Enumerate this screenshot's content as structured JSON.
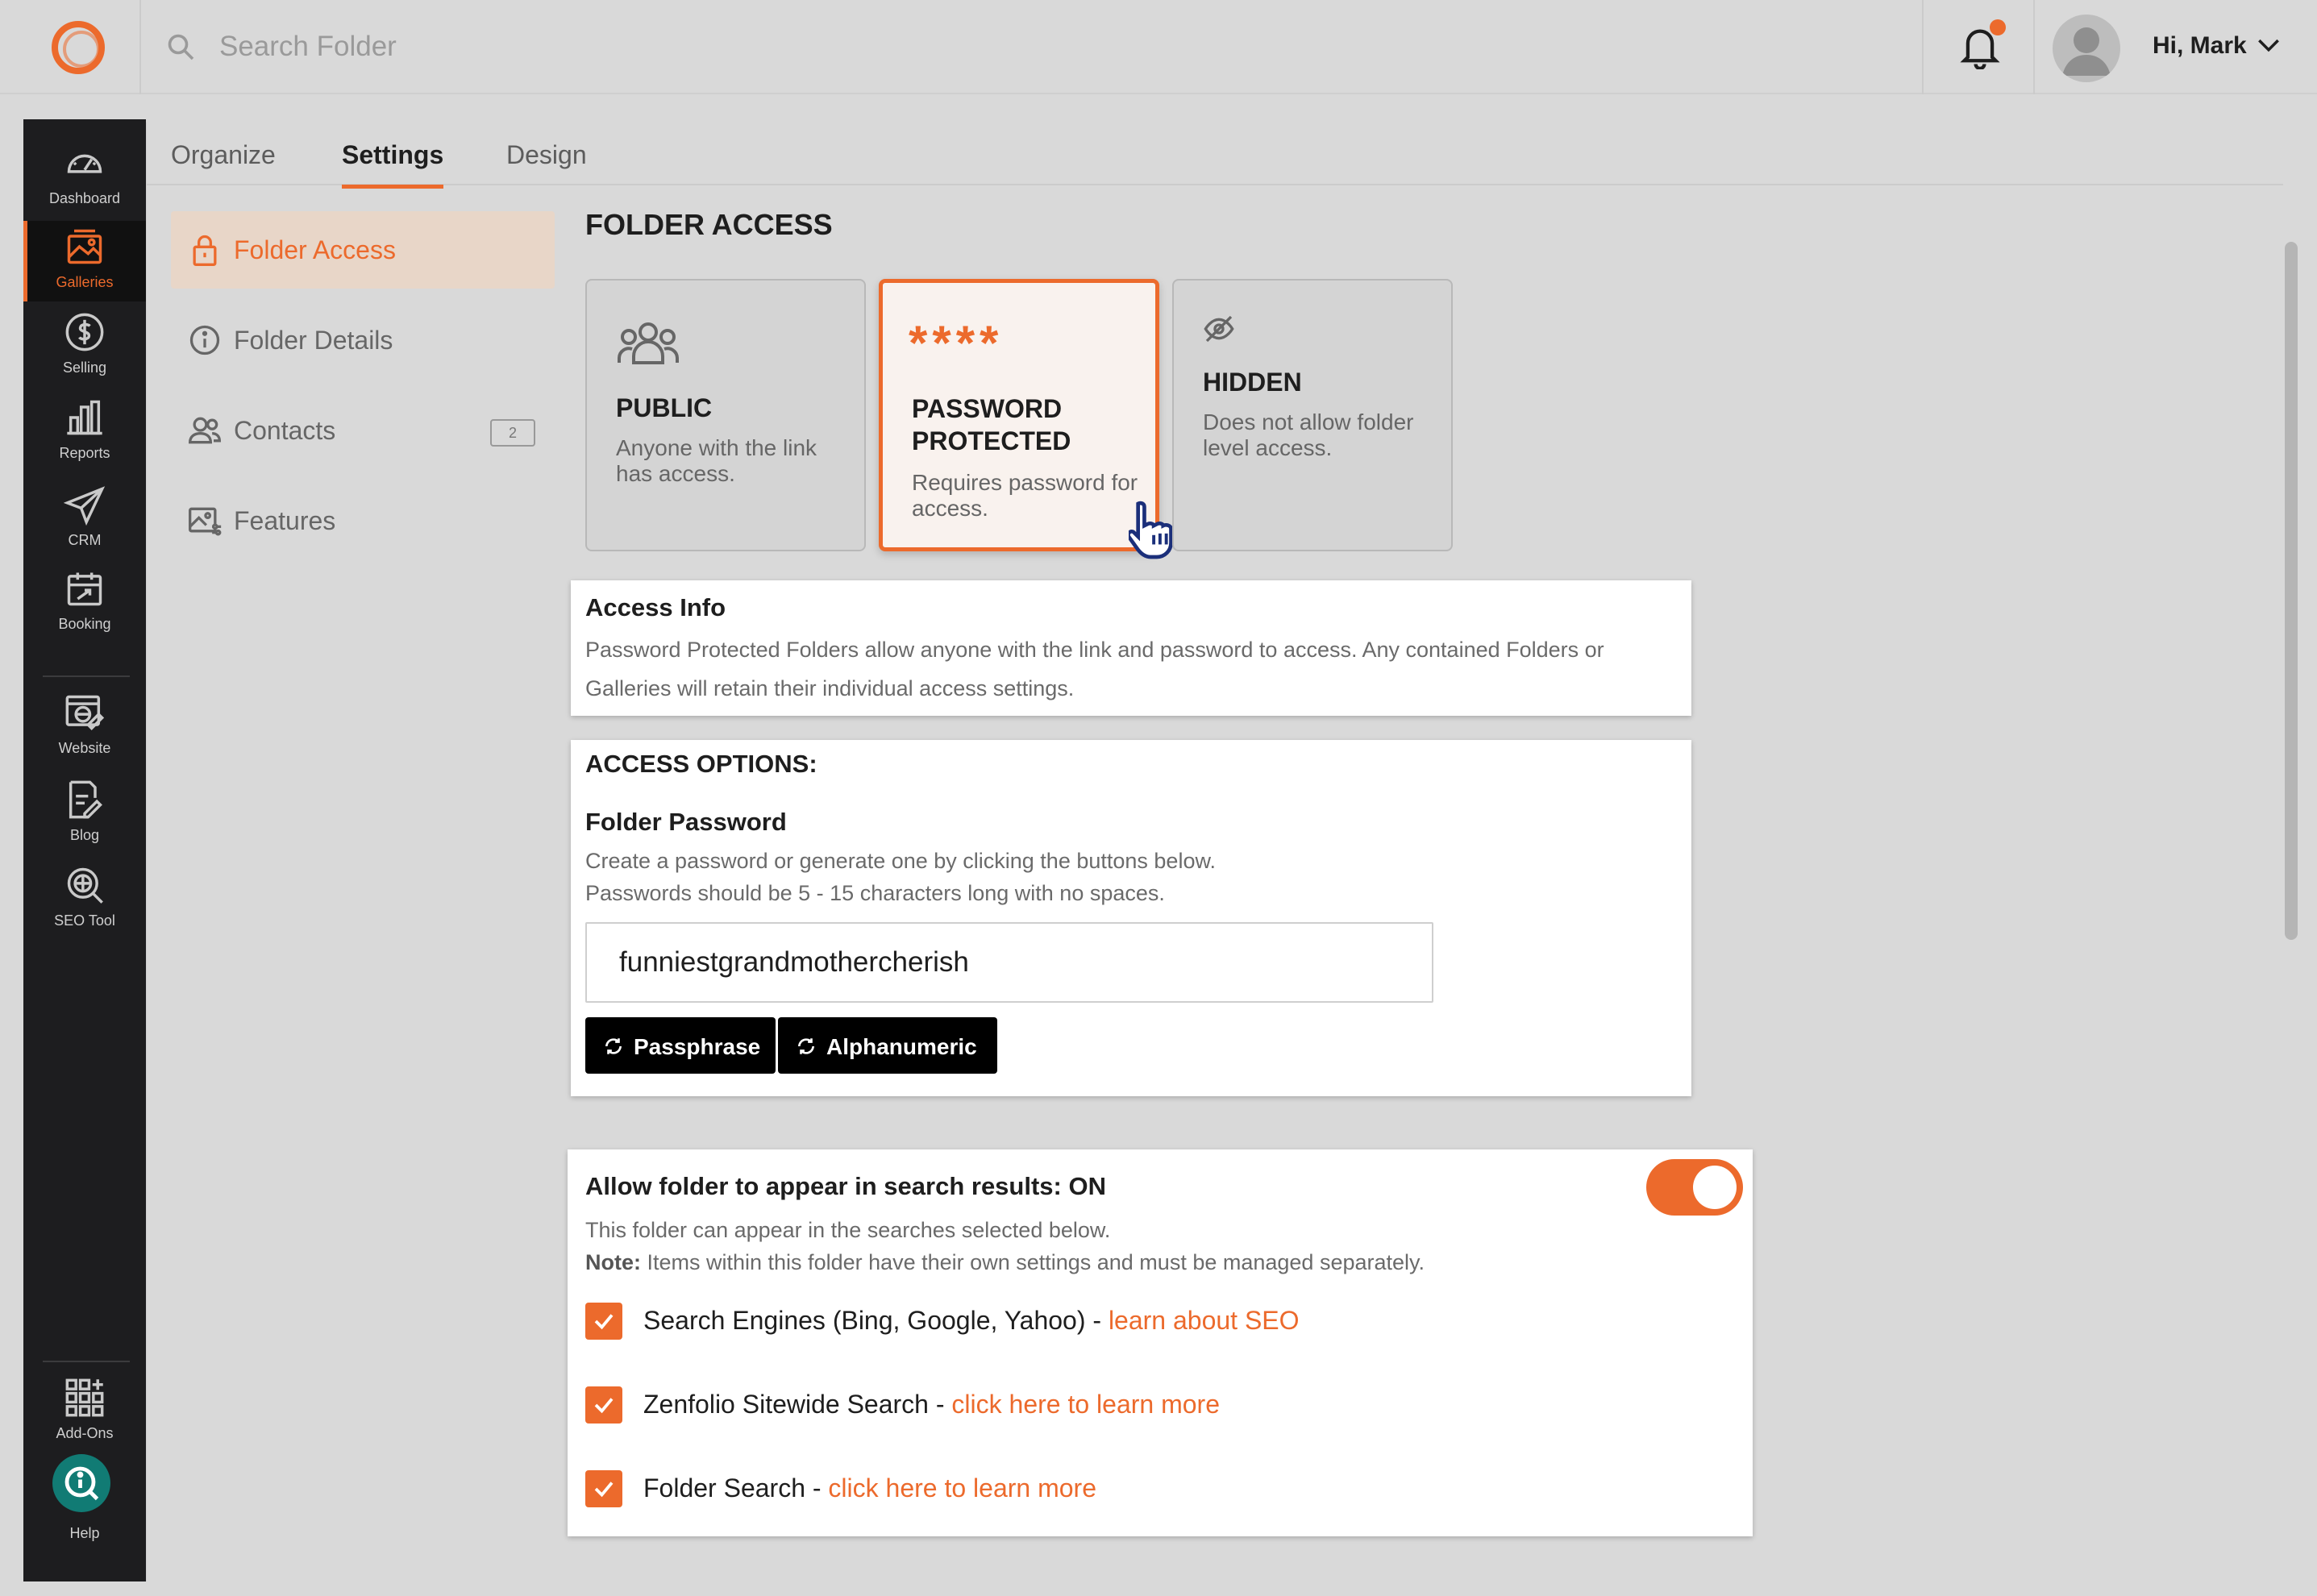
{
  "topbar": {
    "search_placeholder": "Search Folder",
    "greeting": "Hi, Mark"
  },
  "sidebar": {
    "items": [
      {
        "label": "Dashboard",
        "icon": "dashboard-icon"
      },
      {
        "label": "Galleries",
        "icon": "galleries-icon",
        "active": true
      },
      {
        "label": "Selling",
        "icon": "dollar-icon"
      },
      {
        "label": "Reports",
        "icon": "bar-chart-icon"
      },
      {
        "label": "CRM",
        "icon": "paper-plane-icon"
      },
      {
        "label": "Booking",
        "icon": "calendar-icon"
      },
      {
        "label": "Website",
        "icon": "website-icon"
      },
      {
        "label": "Blog",
        "icon": "blog-icon"
      },
      {
        "label": "SEO Tool",
        "icon": "seo-globe-icon"
      }
    ],
    "addons_label": "Add-Ons",
    "help_label": "Help"
  },
  "tabs": {
    "organize": "Organize",
    "settings": "Settings",
    "design": "Design",
    "active": "Settings"
  },
  "subnav": {
    "items": [
      {
        "label": "Folder Access",
        "icon": "lock-icon"
      },
      {
        "label": "Folder Details",
        "icon": "info-icon"
      },
      {
        "label": "Contacts",
        "icon": "contacts-icon",
        "count": "2"
      },
      {
        "label": "Features",
        "icon": "features-icon"
      }
    ]
  },
  "folder_access": {
    "title": "FOLDER ACCESS",
    "cards": [
      {
        "title": "PUBLIC",
        "desc": "Anyone with the link has access."
      },
      {
        "title_line1": "PASSWORD",
        "title_line2": "PROTECTED",
        "desc": "Requires password for access.",
        "stars": "****",
        "selected": true
      },
      {
        "title": "HIDDEN",
        "desc": "Does not allow folder level access."
      }
    ]
  },
  "access_info": {
    "heading": "Access Info",
    "body": "Password Protected Folders allow anyone with the link and password to access. Any contained Folders or Galleries will retain their individual access settings."
  },
  "access_options": {
    "heading": "ACCESS OPTIONS:",
    "password_label": "Folder Password",
    "help_line1": "Create a password or generate one by clicking the buttons below.",
    "help_line2": "Passwords should be 5 - 15 characters long with no spaces.",
    "password_value": "funniestgrandmothercherish",
    "passphrase_btn": "Passphrase",
    "alphanumeric_btn": "Alphanumeric"
  },
  "search_results": {
    "heading": "Allow folder to appear in search results: ON",
    "toggle_state": "ON",
    "desc": "This folder can appear in the searches selected below.",
    "note_label": "Note:",
    "note_text": " Items within this folder have their own settings and must be managed separately.",
    "options": [
      {
        "label": "Search Engines (Bing, Google, Yahoo) - ",
        "link": "learn about SEO",
        "checked": true
      },
      {
        "label": "Zenfolio Sitewide Search - ",
        "link": "click here to learn more",
        "checked": true
      },
      {
        "label": "Folder Search - ",
        "link": "click here to learn more",
        "checked": true
      }
    ]
  },
  "colors": {
    "accent": "#ec6a2c",
    "sidebar_bg": "#1d1d1f",
    "help_bg": "#117b74"
  }
}
